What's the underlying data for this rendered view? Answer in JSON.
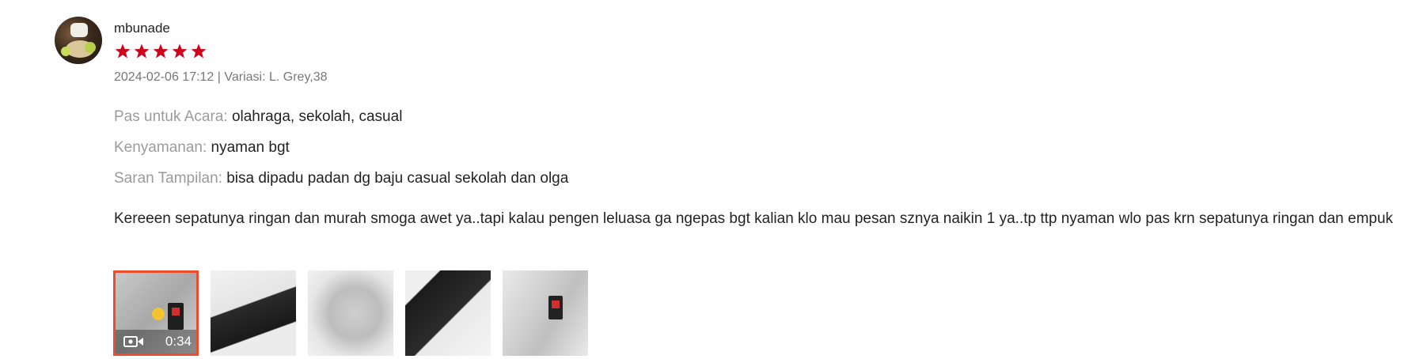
{
  "review": {
    "author": "mbunade",
    "rating": 5,
    "rating_max": 5,
    "meta": "2024-02-06 17:12 | Variasi: L. Grey,38",
    "attributes": [
      {
        "key": "Pas untuk Acara:",
        "value": "olahraga, sekolah, casual"
      },
      {
        "key": "Kenyamanan:",
        "value": "nyaman bgt"
      },
      {
        "key": "Saran Tampilan:",
        "value": "bisa dipadu padan dg baju casual sekolah dan olga"
      }
    ],
    "comment": "Kereeen sepatunya ringan dan murah smoga awet ya..tapi kalau pengen leluasa ga ngepas bgt kalian klo mau pesan sznya naikin 1 ya..tp ttp nyaman wlo pas krn sepatunya ringan dan empuk",
    "media": {
      "video_duration": "0:34",
      "video_icon": "video-camera-icon",
      "thumbnail_count": 5
    }
  },
  "colors": {
    "star": "#d0011b",
    "active_border": "#ee4d2d",
    "label": "rgba(0,0,0,0.40)",
    "meta": "rgba(0,0,0,0.54)"
  }
}
